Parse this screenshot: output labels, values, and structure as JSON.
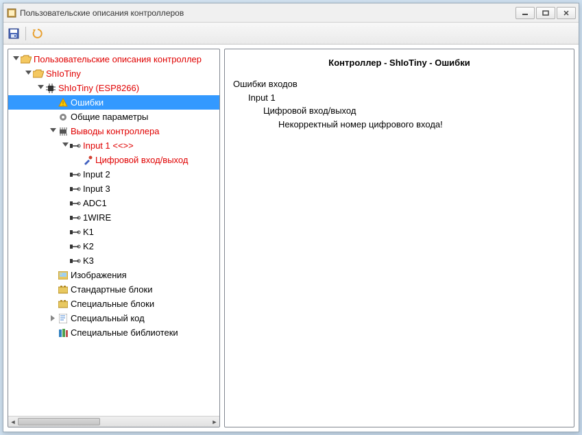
{
  "window": {
    "title": "Пользовательские описания контроллеров"
  },
  "toolbar": {
    "save": "Сохранить",
    "refresh": "Обновить"
  },
  "tree": {
    "root": "Пользовательские описания контроллер",
    "shlotiny": "ShIoTiny",
    "shiotiny_dev": "ShIoTiny (ESP8266)",
    "errors": "Ошибки",
    "general_params": "Общие параметры",
    "controller_pins": "Выводы контроллера",
    "input1": "Input 1  <<>>",
    "digital_io": "Цифровой вход/выход",
    "input2": "Input 2",
    "input3": "Input 3",
    "adc1": "ADC1",
    "1wire": "1WIRE",
    "k1": "K1",
    "k2": "K2",
    "k3": "K3",
    "images": "Изображения",
    "std_blocks": "Стандартные блоки",
    "spec_blocks": "Специальные блоки",
    "spec_code": "Специальный код",
    "spec_libs": "Специальные библиотеки"
  },
  "detail": {
    "title": "Контроллер - ShIoTiny - Ошибки",
    "line0": "Ошибки входов",
    "line1": "Input 1",
    "line2": "Цифровой вход/выход",
    "line3": "Некорректный номер цифрового входа!"
  }
}
